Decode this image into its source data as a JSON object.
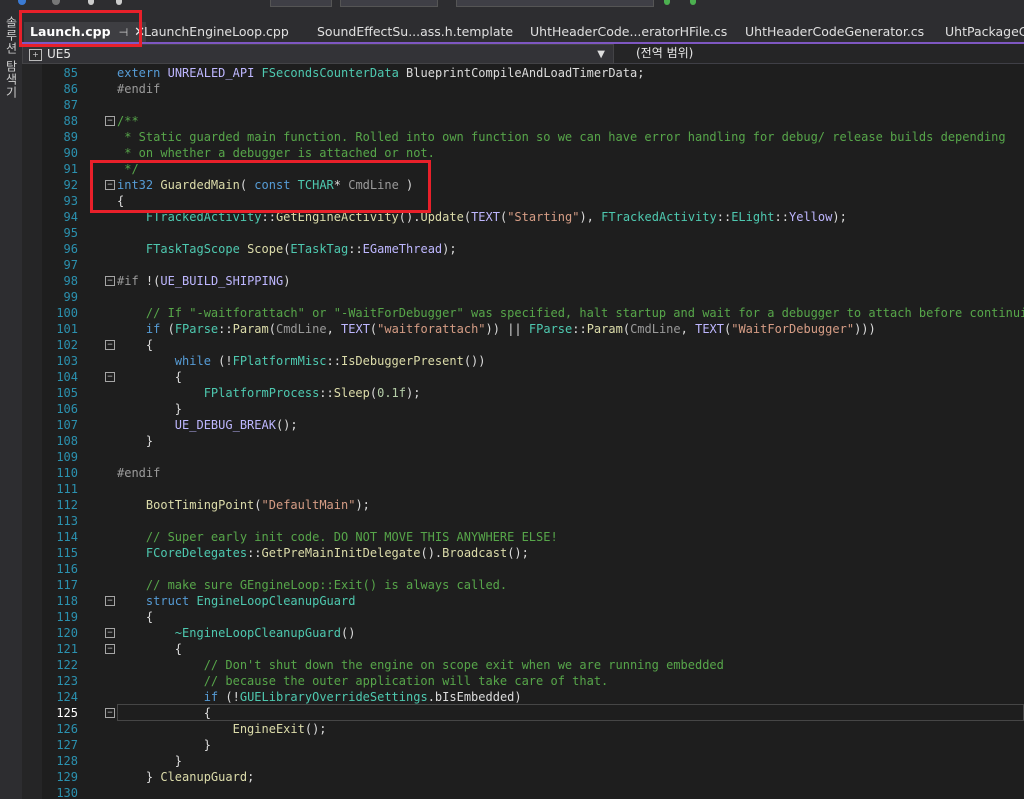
{
  "side_panel": {
    "label": "솔루션 탐색기"
  },
  "tabs": [
    {
      "label": "Launch.cpp",
      "active": true,
      "pinned": true
    },
    {
      "label": "LaunchEngineLoop.cpp"
    },
    {
      "label": "SoundEffectSu...ass.h.template"
    },
    {
      "label": "UhtHeaderCode...eratorHFile.cs"
    },
    {
      "label": "UhtHeaderCodeGenerator.cs"
    },
    {
      "label": "UhtPackageCo"
    }
  ],
  "navbar": {
    "project": "UE5",
    "scope": "(전역 범위)"
  },
  "editor": {
    "current_line": 125,
    "lines": [
      {
        "n": 85,
        "t": "extern UNREALED_API FSecondsCounterData BlueprintCompileAndLoadTimerData;"
      },
      {
        "n": 86,
        "t": "#endif"
      },
      {
        "n": 87,
        "t": ""
      },
      {
        "n": 88,
        "t": "/**"
      },
      {
        "n": 89,
        "t": " * Static guarded main function. Rolled into own function so we can have error handling for debug/ release builds depending"
      },
      {
        "n": 90,
        "t": " * on whether a debugger is attached or not."
      },
      {
        "n": 91,
        "t": " */"
      },
      {
        "n": 92,
        "t": "int32 GuardedMain( const TCHAR* CmdLine )"
      },
      {
        "n": 93,
        "t": "{"
      },
      {
        "n": 94,
        "t": "    FTrackedActivity::GetEngineActivity().Update(TEXT(\"Starting\"), FTrackedActivity::ELight::Yellow);"
      },
      {
        "n": 95,
        "t": ""
      },
      {
        "n": 96,
        "t": "    FTaskTagScope Scope(ETaskTag::EGameThread);"
      },
      {
        "n": 97,
        "t": ""
      },
      {
        "n": 98,
        "t": "#if !(UE_BUILD_SHIPPING)"
      },
      {
        "n": 99,
        "t": ""
      },
      {
        "n": 100,
        "t": "    // If \"-waitforattach\" or \"-WaitForDebugger\" was specified, halt startup and wait for a debugger to attach before continuing"
      },
      {
        "n": 101,
        "t": "    if (FParse::Param(CmdLine, TEXT(\"waitforattach\")) || FParse::Param(CmdLine, TEXT(\"WaitForDebugger\")))"
      },
      {
        "n": 102,
        "t": "    {"
      },
      {
        "n": 103,
        "t": "        while (!FPlatformMisc::IsDebuggerPresent())"
      },
      {
        "n": 104,
        "t": "        {"
      },
      {
        "n": 105,
        "t": "            FPlatformProcess::Sleep(0.1f);"
      },
      {
        "n": 106,
        "t": "        }"
      },
      {
        "n": 107,
        "t": "        UE_DEBUG_BREAK();"
      },
      {
        "n": 108,
        "t": "    }"
      },
      {
        "n": 109,
        "t": ""
      },
      {
        "n": 110,
        "t": "#endif"
      },
      {
        "n": 111,
        "t": ""
      },
      {
        "n": 112,
        "t": "    BootTimingPoint(\"DefaultMain\");"
      },
      {
        "n": 113,
        "t": ""
      },
      {
        "n": 114,
        "t": "    // Super early init code. DO NOT MOVE THIS ANYWHERE ELSE!"
      },
      {
        "n": 115,
        "t": "    FCoreDelegates::GetPreMainInitDelegate().Broadcast();"
      },
      {
        "n": 116,
        "t": ""
      },
      {
        "n": 117,
        "t": "    // make sure GEngineLoop::Exit() is always called."
      },
      {
        "n": 118,
        "t": "    struct EngineLoopCleanupGuard"
      },
      {
        "n": 119,
        "t": "    {"
      },
      {
        "n": 120,
        "t": "        ~EngineLoopCleanupGuard()"
      },
      {
        "n": 121,
        "t": "        {"
      },
      {
        "n": 122,
        "t": "            // Don't shut down the engine on scope exit when we are running embedded"
      },
      {
        "n": 123,
        "t": "            // because the outer application will take care of that."
      },
      {
        "n": 124,
        "t": "            if (!GUELibraryOverrideSettings.bIsEmbedded)"
      },
      {
        "n": 125,
        "t": "            {"
      },
      {
        "n": 126,
        "t": "                EngineExit();"
      },
      {
        "n": 127,
        "t": "            }"
      },
      {
        "n": 128,
        "t": "        }"
      },
      {
        "n": 129,
        "t": "    } CleanupGuard;"
      },
      {
        "n": 130,
        "t": ""
      }
    ]
  },
  "colors": {
    "highlight_box": "#e8202a",
    "tab_accent": "#7e57c2"
  }
}
